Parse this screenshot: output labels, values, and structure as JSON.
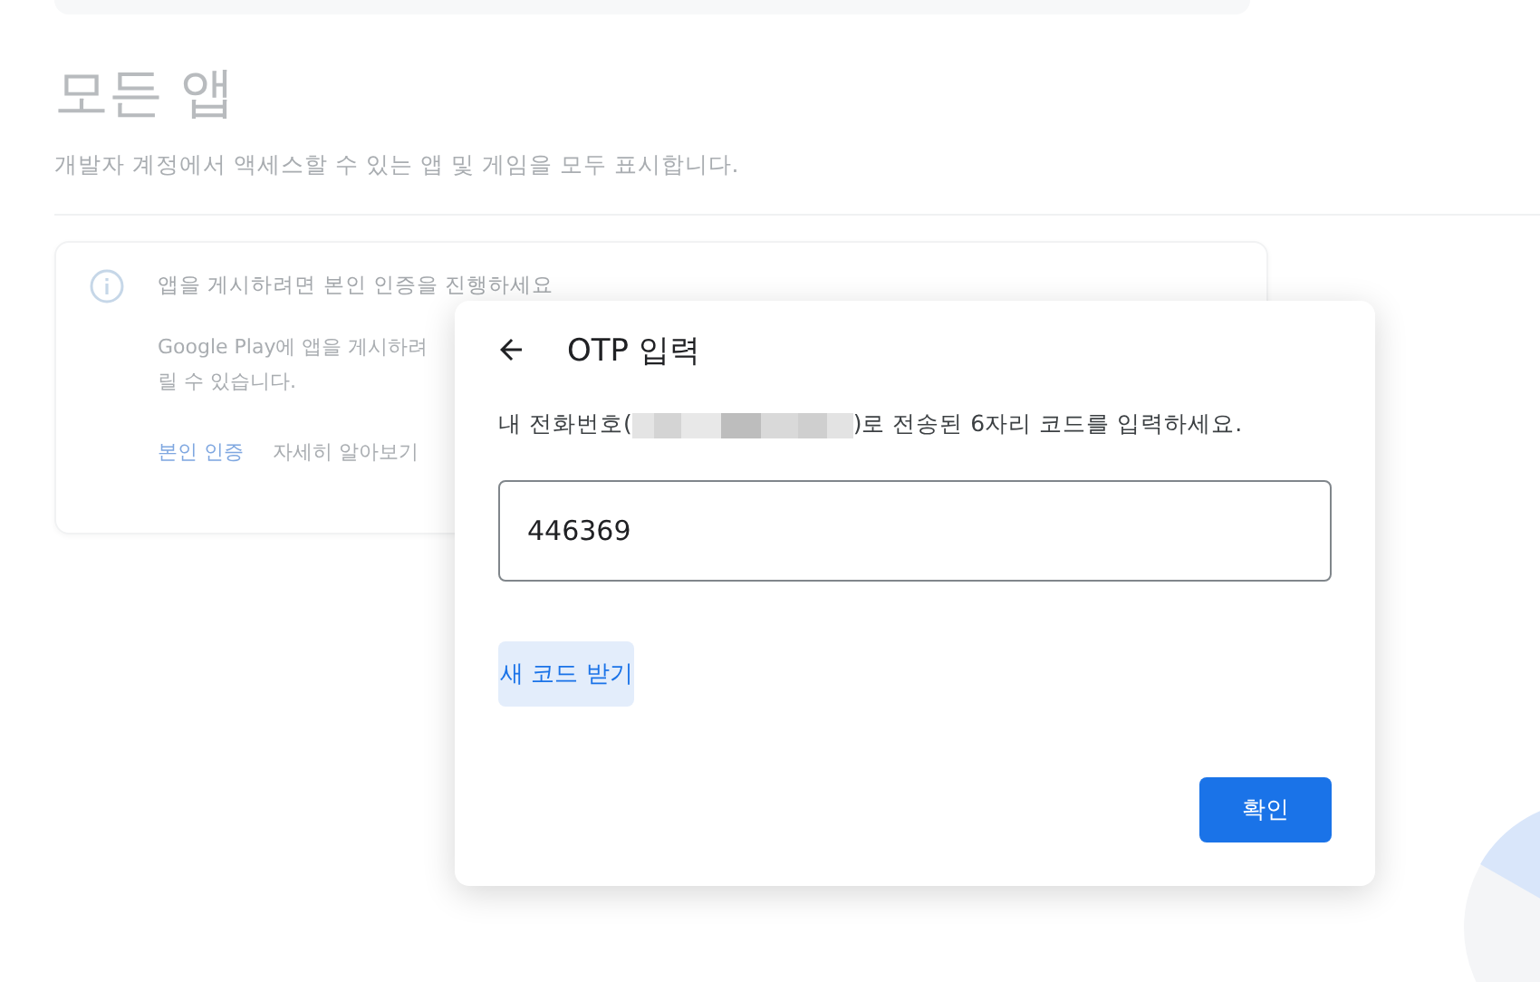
{
  "page": {
    "title": "모든 앱",
    "subtitle": "개발자 계정에서 액세스할 수 있는 앱 및 게임을 모두 표시합니다."
  },
  "notice": {
    "title": "앱을 게시하려면 본인 인증을 진행하세요",
    "body_lines": [
      "Google Play에 앱을 게시하려",
      "릴 수 있습니다."
    ],
    "links": [
      {
        "label": "본인 인증",
        "kind": "primary"
      },
      {
        "label": "자세히 알아보기",
        "kind": "secondary"
      }
    ]
  },
  "dialog": {
    "title": "OTP 입력",
    "message_before": "내 전화번호(",
    "message_after": ")로 전송된 6자리 코드를 입력하세요.",
    "code_field": {
      "value": "446369"
    },
    "resend_button": "새 코드 받기",
    "confirm_button": "확인"
  }
}
